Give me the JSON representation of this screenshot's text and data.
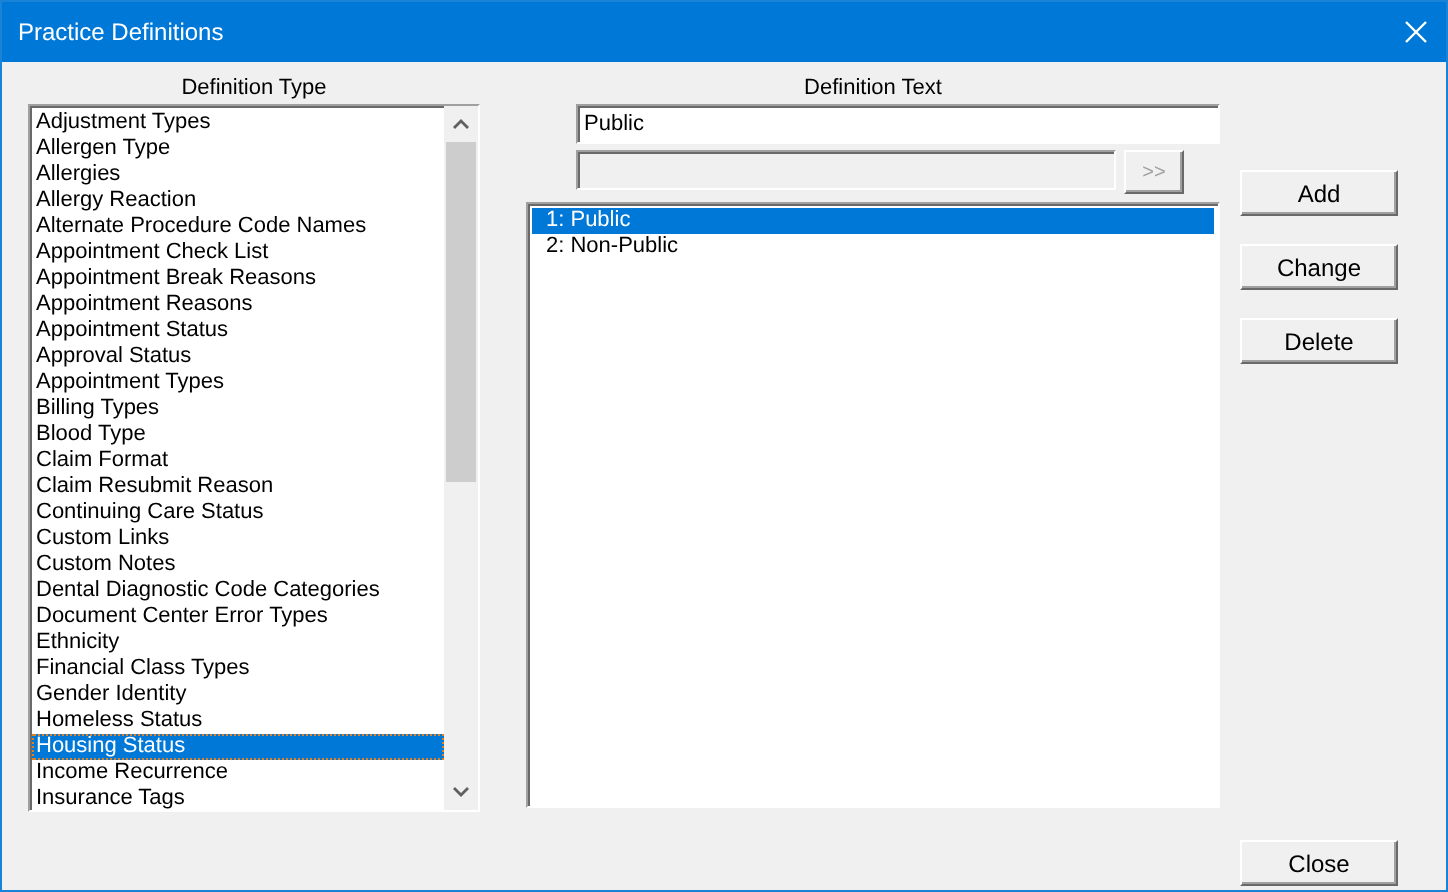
{
  "window": {
    "title": "Practice Definitions"
  },
  "definition_type": {
    "label": "Definition Type",
    "items": [
      {
        "label": "Adjustment Types",
        "selected": false
      },
      {
        "label": "Allergen Type",
        "selected": false
      },
      {
        "label": "Allergies",
        "selected": false
      },
      {
        "label": "Allergy Reaction",
        "selected": false
      },
      {
        "label": "Alternate Procedure Code Names",
        "selected": false
      },
      {
        "label": "Appointment Check List",
        "selected": false
      },
      {
        "label": "Appointment Break Reasons",
        "selected": false
      },
      {
        "label": "Appointment Reasons",
        "selected": false
      },
      {
        "label": "Appointment Status",
        "selected": false
      },
      {
        "label": "Approval Status",
        "selected": false
      },
      {
        "label": "Appointment Types",
        "selected": false
      },
      {
        "label": "Billing Types",
        "selected": false
      },
      {
        "label": "Blood Type",
        "selected": false
      },
      {
        "label": "Claim Format",
        "selected": false
      },
      {
        "label": "Claim Resubmit Reason",
        "selected": false
      },
      {
        "label": "Continuing Care Status",
        "selected": false
      },
      {
        "label": "Custom Links",
        "selected": false
      },
      {
        "label": "Custom Notes",
        "selected": false
      },
      {
        "label": "Dental Diagnostic Code Categories",
        "selected": false
      },
      {
        "label": "Document Center Error Types",
        "selected": false
      },
      {
        "label": "Ethnicity",
        "selected": false
      },
      {
        "label": "Financial Class Types",
        "selected": false
      },
      {
        "label": "Gender Identity",
        "selected": false
      },
      {
        "label": "Homeless Status",
        "selected": false
      },
      {
        "label": "Housing Status",
        "selected": true
      },
      {
        "label": "Income Recurrence",
        "selected": false
      },
      {
        "label": "Insurance Tags",
        "selected": false
      }
    ]
  },
  "definition_text": {
    "label": "Definition Text",
    "value": "Public",
    "secondary_field": {
      "disabled": true
    },
    "transfer_button": {
      "label": ">>",
      "disabled": true
    },
    "items": [
      {
        "label": "1: Public",
        "selected": true
      },
      {
        "label": "2: Non-Public",
        "selected": false
      }
    ]
  },
  "buttons": [
    "Add",
    "Change",
    "Delete"
  ],
  "close_button": "Close"
}
